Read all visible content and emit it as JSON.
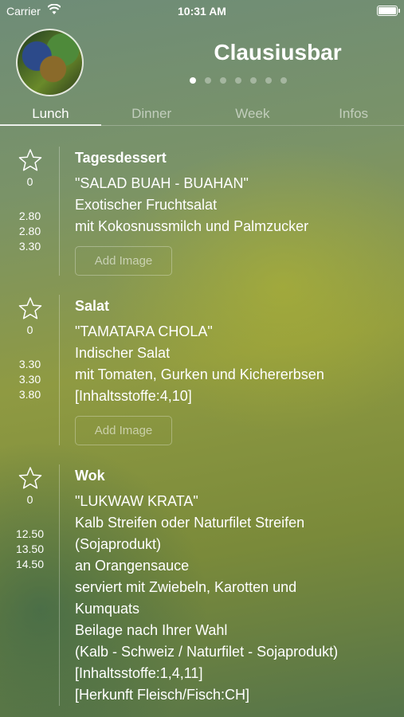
{
  "status_bar": {
    "carrier": "Carrier",
    "time": "10:31 AM"
  },
  "header": {
    "title": "Clausiusbar",
    "page_count": 7,
    "active_page": 0
  },
  "tabs": [
    {
      "label": "Lunch",
      "active": true
    },
    {
      "label": "Dinner",
      "active": false
    },
    {
      "label": "Week",
      "active": false
    },
    {
      "label": "Infos",
      "active": false
    }
  ],
  "menu": [
    {
      "category": "Tagesdessert",
      "rating": "0",
      "prices": [
        "2.80",
        "2.80",
        "3.30"
      ],
      "lines": [
        "\"SALAD BUAH - BUAHAN\"",
        "Exotischer Fruchtsalat",
        "mit Kokosnussmilch und Palmzucker"
      ],
      "add_image_label": "Add Image"
    },
    {
      "category": "Salat",
      "rating": "0",
      "prices": [
        "3.30",
        "3.30",
        "3.80"
      ],
      "lines": [
        "\"TAMATARA CHOLA\"",
        "Indischer Salat",
        "mit Tomaten, Gurken und Kichererbsen",
        "[Inhaltsstoffe:4,10]"
      ],
      "add_image_label": "Add Image"
    },
    {
      "category": "Wok",
      "rating": "0",
      "prices": [
        "12.50",
        "13.50",
        "14.50"
      ],
      "lines": [
        "\"LUKWAW KRATA\"",
        "Kalb Streifen oder Naturfilet Streifen",
        "(Sojaprodukt)",
        "an Orangensauce",
        "serviert mit Zwiebeln, Karotten und",
        "Kumquats",
        "Beilage nach Ihrer Wahl",
        "(Kalb - Schweiz / Naturfilet - Sojaprodukt)",
        "[Inhaltsstoffe:1,4,11]",
        "[Herkunft Fleisch/Fisch:CH]"
      ],
      "add_image_label": ""
    }
  ]
}
